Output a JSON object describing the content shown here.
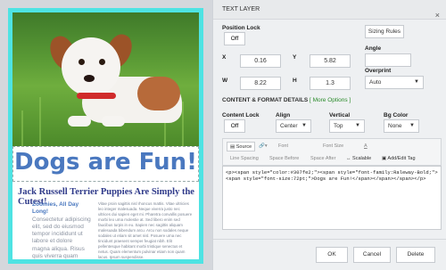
{
  "canvas": {
    "headline": "Dogs are Fun!",
    "subtitle": "Jack Russell Terrier Puppies Are Simply the Cutest!",
    "col_a_lead": "Zoomies, All Day Long!",
    "col_a_body": "Consectetur adipiscing elit, sed do eiusmod tempor incididunt ut labore et dolore magna aliqua. Risus quis viverra quam quisque id.",
    "col_b_body": "Vitae proin sagittis nisl rhoncus mattis. Vitae ultricies leo integer malesuada. Neque viverra justo nec ultrices dui sapien eget mi. Pharetra convallis posuere morbi leo urna molestie at. Sed libero enim sed faucibus turpis in eu. Sapien nec sagittis aliquam malesuada bibendum arcu. Arcu non sodales neque sodales ut etiam sit amet nisl. Posuere urna nec tincidunt praesent semper feugiat nibh. Elit pellentesque habitant morbi tristique senectus et netus. Quam elementum pulvinar etiam non quam lacus. Ipsum suspendisse."
  },
  "panel": {
    "title": "TEXT LAYER",
    "close_icon": "×",
    "position_lock_label": "Position Lock",
    "position_lock_value": "Off",
    "sizing_rules_label": "Sizing Rules",
    "x_label": "X",
    "x_value": "0.16",
    "y_label": "Y",
    "y_value": "5.82",
    "w_label": "W",
    "w_value": "8.22",
    "h_label": "H",
    "h_value": "1.3",
    "angle_label": "Angle",
    "angle_value": "",
    "overprint_label": "Overprint",
    "overprint_value": "Auto",
    "section_title": "CONTENT & FORMAT DETAILS",
    "more_options": "[ More Options ]",
    "content_lock_label": "Content Lock",
    "content_lock_value": "Off",
    "align_label": "Align",
    "align_value": "Center",
    "vertical_label": "Vertical",
    "vertical_value": "Top",
    "bg_color_label": "Bg Color",
    "bg_color_value": "None",
    "toolbar": {
      "source": "Source",
      "font": "Font",
      "font_size": "Font Size",
      "text_color": "A",
      "line_spacing": "Line Spacing",
      "space_before": "Space Before",
      "space_after": "Space After",
      "scalable": "Scalable",
      "add_edit_tag": "Add/Edit Tag"
    },
    "source_code": "<p><span style=\"color:#307fe2;\"><span style=\"font-family:Raleway-Bold;\"><span style=\"font-size:72pt;\">Dogs are Fun!</span></span></span></p>",
    "ok": "OK",
    "cancel": "Cancel",
    "delete": "Delete"
  },
  "colors": {
    "frame": "#4ee3e3",
    "headline": "#4a78bf",
    "subtitle": "#2f3a8a",
    "more_options": "#2a8a2a"
  }
}
